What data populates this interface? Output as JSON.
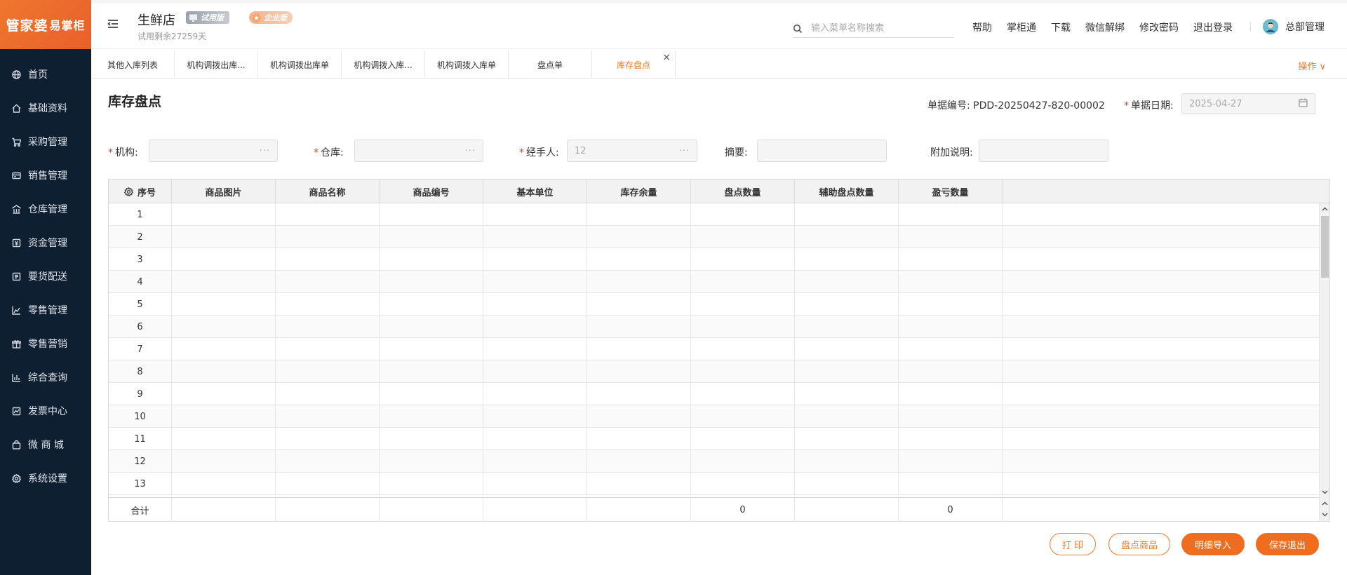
{
  "app": {
    "logo_main": "管家婆",
    "logo_sub": "易掌柜"
  },
  "sidebar": {
    "items": [
      {
        "label": "首页",
        "icon": "globe-icon"
      },
      {
        "label": "基础资料",
        "icon": "home-icon"
      },
      {
        "label": "采购管理",
        "icon": "cart-icon"
      },
      {
        "label": "销售管理",
        "icon": "card-icon"
      },
      {
        "label": "仓库管理",
        "icon": "warehouse-icon"
      },
      {
        "label": "资金管理",
        "icon": "money-icon"
      },
      {
        "label": "要货配送",
        "icon": "list-icon"
      },
      {
        "label": "零售管理",
        "icon": "chart-icon"
      },
      {
        "label": "零售营销",
        "icon": "gift-icon"
      },
      {
        "label": "综合查询",
        "icon": "bar-chart-icon"
      },
      {
        "label": "发票中心",
        "icon": "invoice-icon"
      },
      {
        "label": "微 商 城",
        "icon": "bag-icon"
      },
      {
        "label": "系统设置",
        "icon": "gear-icon"
      }
    ]
  },
  "header": {
    "store_name": "生鲜店",
    "trial_badge": "试用版",
    "enterprise_badge": "企业版",
    "trial_remaining": "试用剩余27259天",
    "search_placeholder": "输入菜单名称搜索",
    "links": [
      "帮助",
      "掌柜通",
      "下载",
      "微信解绑",
      "修改密码",
      "退出登录"
    ],
    "user_name": "总部管理"
  },
  "tabs": {
    "items": [
      {
        "label": "其他入库列表",
        "active": false
      },
      {
        "label": "机构调拨出库...",
        "active": false
      },
      {
        "label": "机构调拨出库单",
        "active": false
      },
      {
        "label": "机构调拨入库...",
        "active": false
      },
      {
        "label": "机构调拨入库单",
        "active": false
      },
      {
        "label": "盘点单",
        "active": false
      },
      {
        "label": "库存盘点",
        "active": true
      }
    ],
    "close_glyph": "×",
    "ops_label": "操作 ∨"
  },
  "form": {
    "title": "库存盘点",
    "doc_no_label": "单据编号:",
    "doc_no_value": "PDD-20250427-820-00002",
    "doc_date_label": "单据日期:",
    "doc_date_value": "2025-04-27",
    "org_label": "机构:",
    "warehouse_label": "仓库:",
    "handler_label": "经手人:",
    "handler_value": "12",
    "summary_label": "摘要:",
    "note_label": "附加说明:",
    "dots": "···",
    "required_mark": "*"
  },
  "table": {
    "columns": [
      "序号",
      "商品图片",
      "商品名称",
      "商品编号",
      "基本单位",
      "库存余量",
      "盘点数量",
      "辅助盘点数量",
      "盈亏数量"
    ],
    "rows": [
      "1",
      "2",
      "3",
      "4",
      "5",
      "6",
      "7",
      "8",
      "9",
      "10",
      "11",
      "12",
      "13"
    ],
    "footer": {
      "label": "合计",
      "count_total": "0",
      "profit_loss_total": "0"
    }
  },
  "actions": {
    "print": "打 印",
    "count_goods": "盘点商品",
    "import_detail": "明细导入",
    "save_exit": "保存退出"
  }
}
